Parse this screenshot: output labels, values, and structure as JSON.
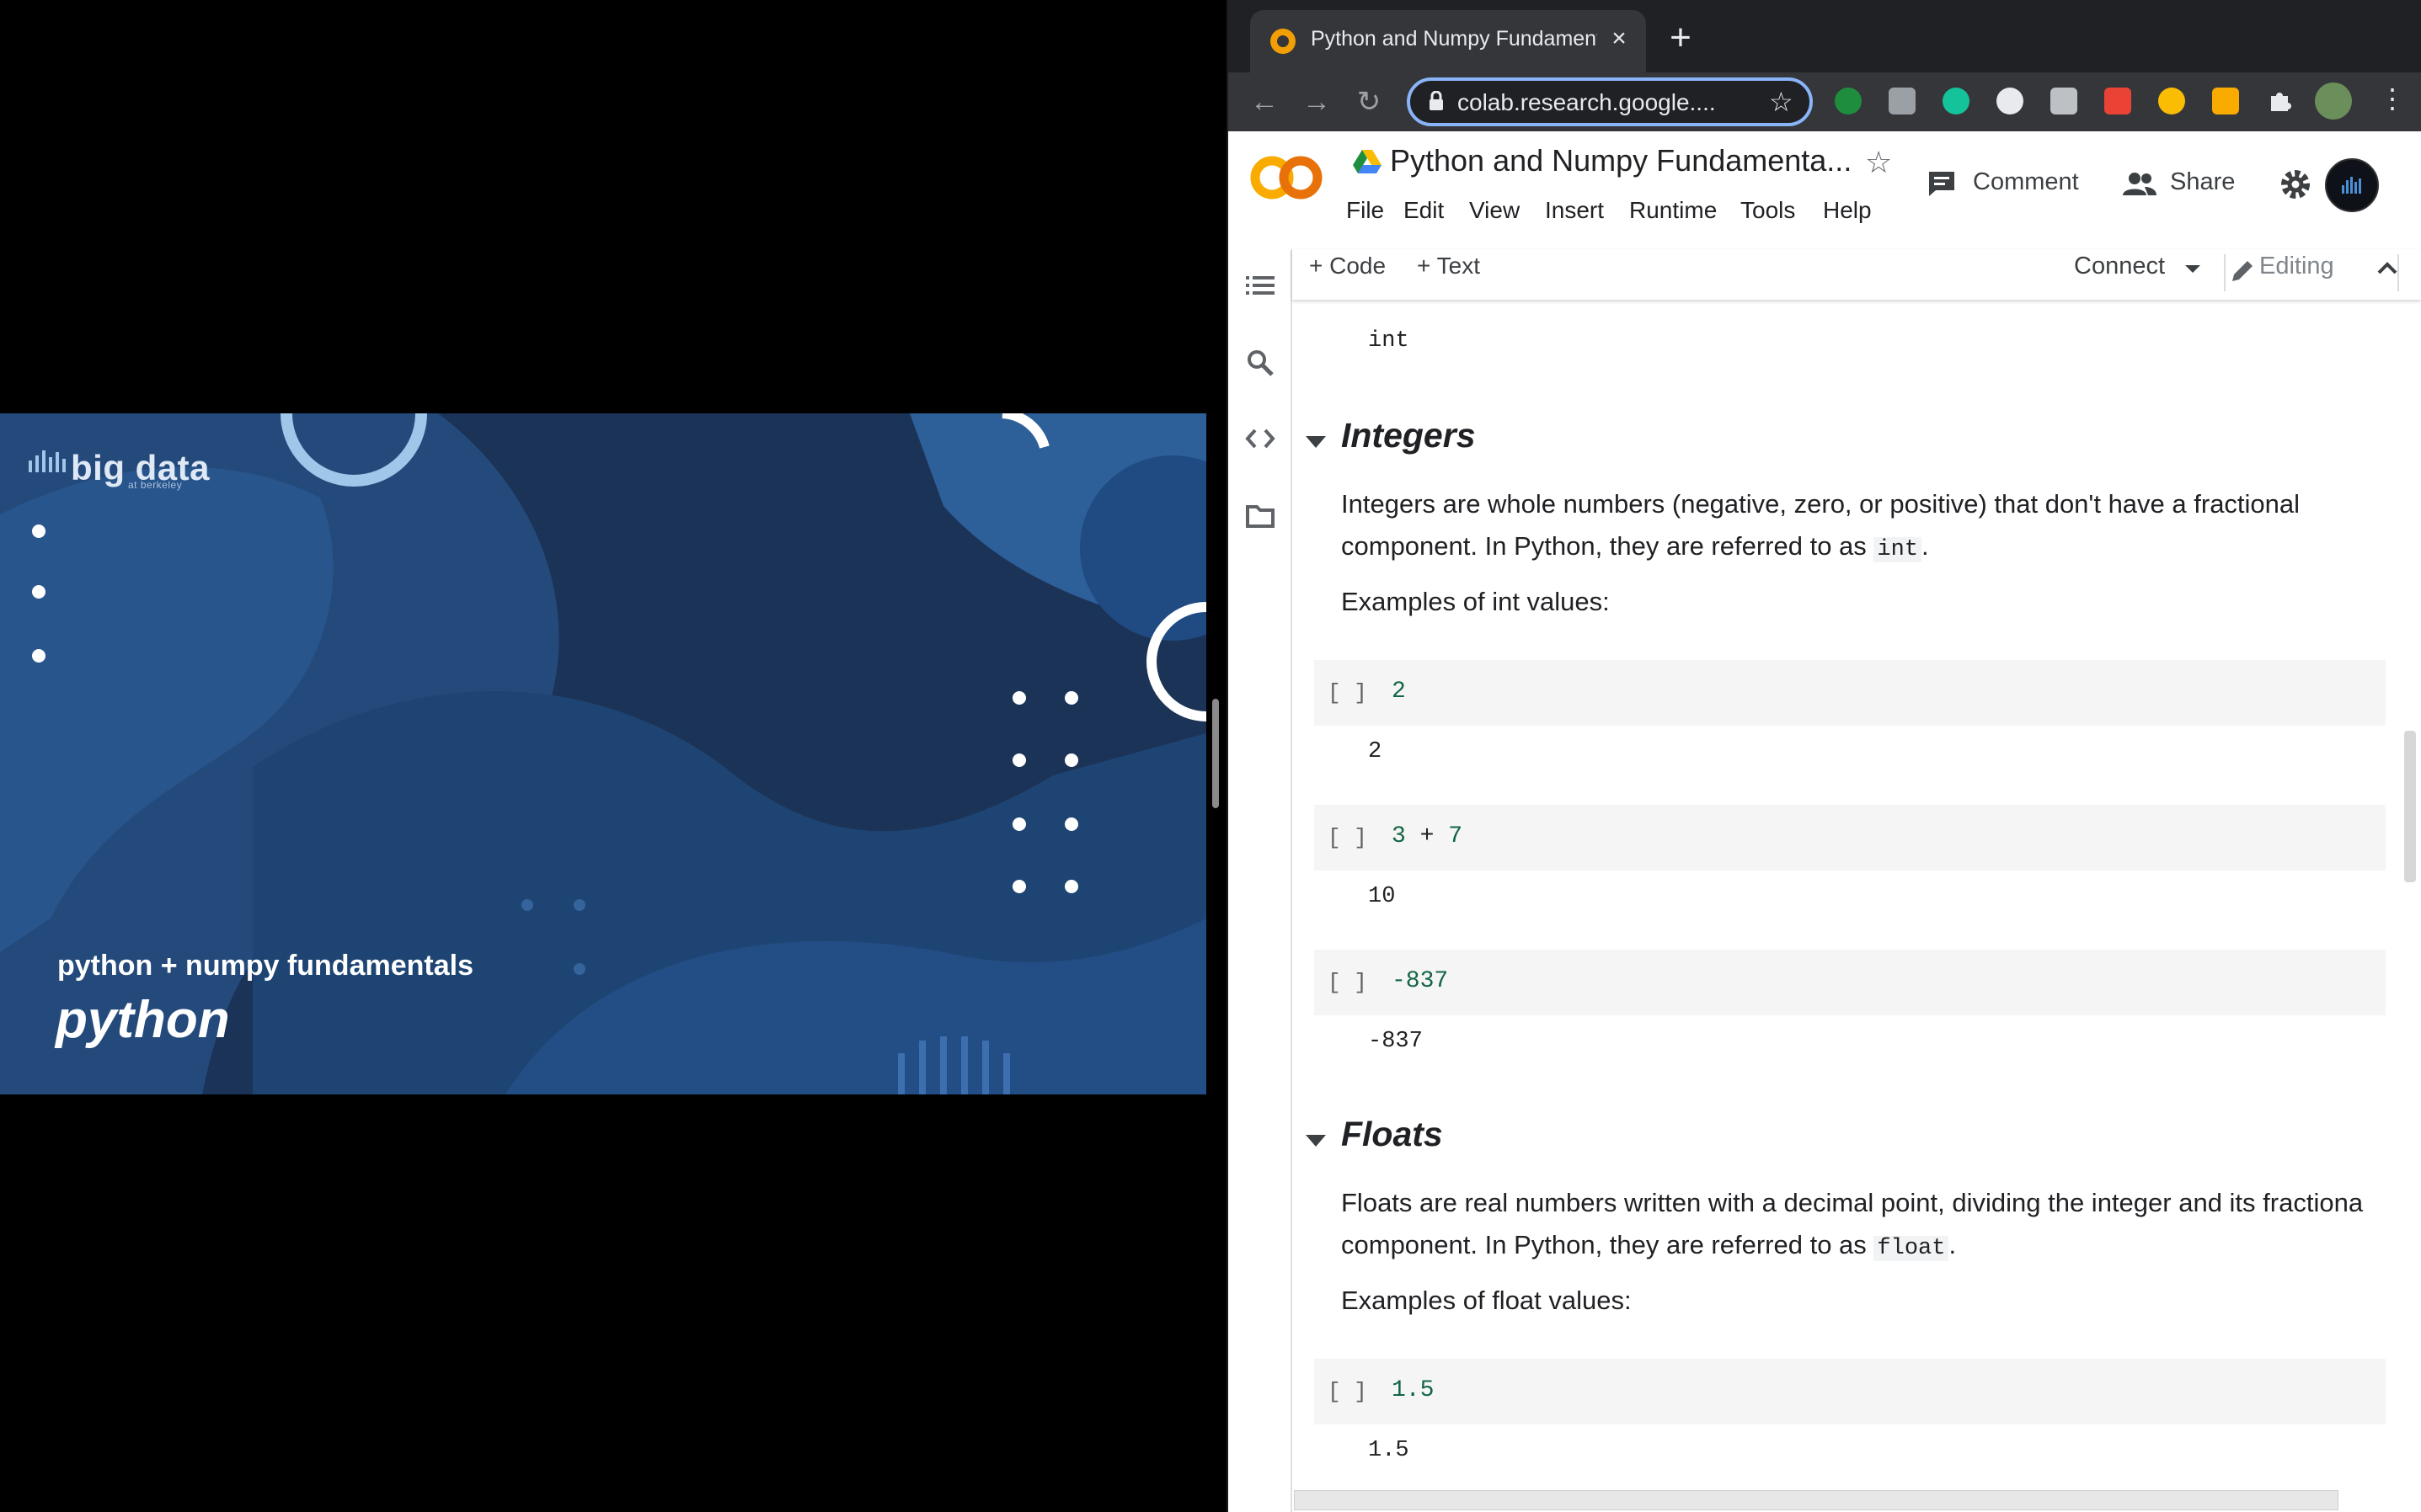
{
  "slide": {
    "brand": "big data",
    "brand_sub": "at berkeley",
    "subtitle": "python + numpy fundamentals",
    "title": "python"
  },
  "browser": {
    "tab_title": "Python and Numpy Fundament",
    "tab_close": "×",
    "new_tab": "+",
    "url": "colab.research.google....",
    "back": "←",
    "forward": "→",
    "reload": "↻",
    "bookmark": "☆",
    "menu": "⋮"
  },
  "colab": {
    "title": "Python and Numpy Fundamenta...",
    "menus": [
      "File",
      "Edit",
      "View",
      "Insert",
      "Runtime",
      "Tools",
      "Help"
    ],
    "comment": "Comment",
    "share": "Share",
    "toolbar": {
      "add_code": "+ Code",
      "add_text": "+ Text",
      "connect": "Connect",
      "editing": "Editing"
    }
  },
  "notebook": {
    "prev_output": "int",
    "integers": {
      "heading": "Integers",
      "para_line1": "Integers are whole numbers (negative, zero, or positive) that don't have a fractional",
      "para_line2_prefix": "component. In Python, they are referred to as ",
      "para_code": "int",
      "para_line2_suffix": ".",
      "examples": "Examples of int values:",
      "cells": [
        {
          "bracket": "[ ]",
          "code": "2",
          "output": "2"
        },
        {
          "bracket": "[ ]",
          "code_a": "3",
          "code_op": "+",
          "code_b": "7",
          "output": "10"
        },
        {
          "bracket": "[ ]",
          "code": "-837",
          "output": "-837"
        }
      ]
    },
    "floats": {
      "heading": "Floats",
      "para_line1": "Floats are real numbers written with a decimal point, dividing the integer and its fractiona",
      "para_line2_prefix": "component. In Python, they are referred to as ",
      "para_code": "float",
      "para_line2_suffix": ".",
      "examples": "Examples of float values:",
      "cells": [
        {
          "bracket": "[ ]",
          "code": "1.5",
          "output": "1.5"
        }
      ]
    }
  },
  "colors": {
    "slide_dark": "#1a2d4d",
    "slide_mid": "#244a7c",
    "code_green": "#116644",
    "accent_blue": "#8ab4f8"
  }
}
